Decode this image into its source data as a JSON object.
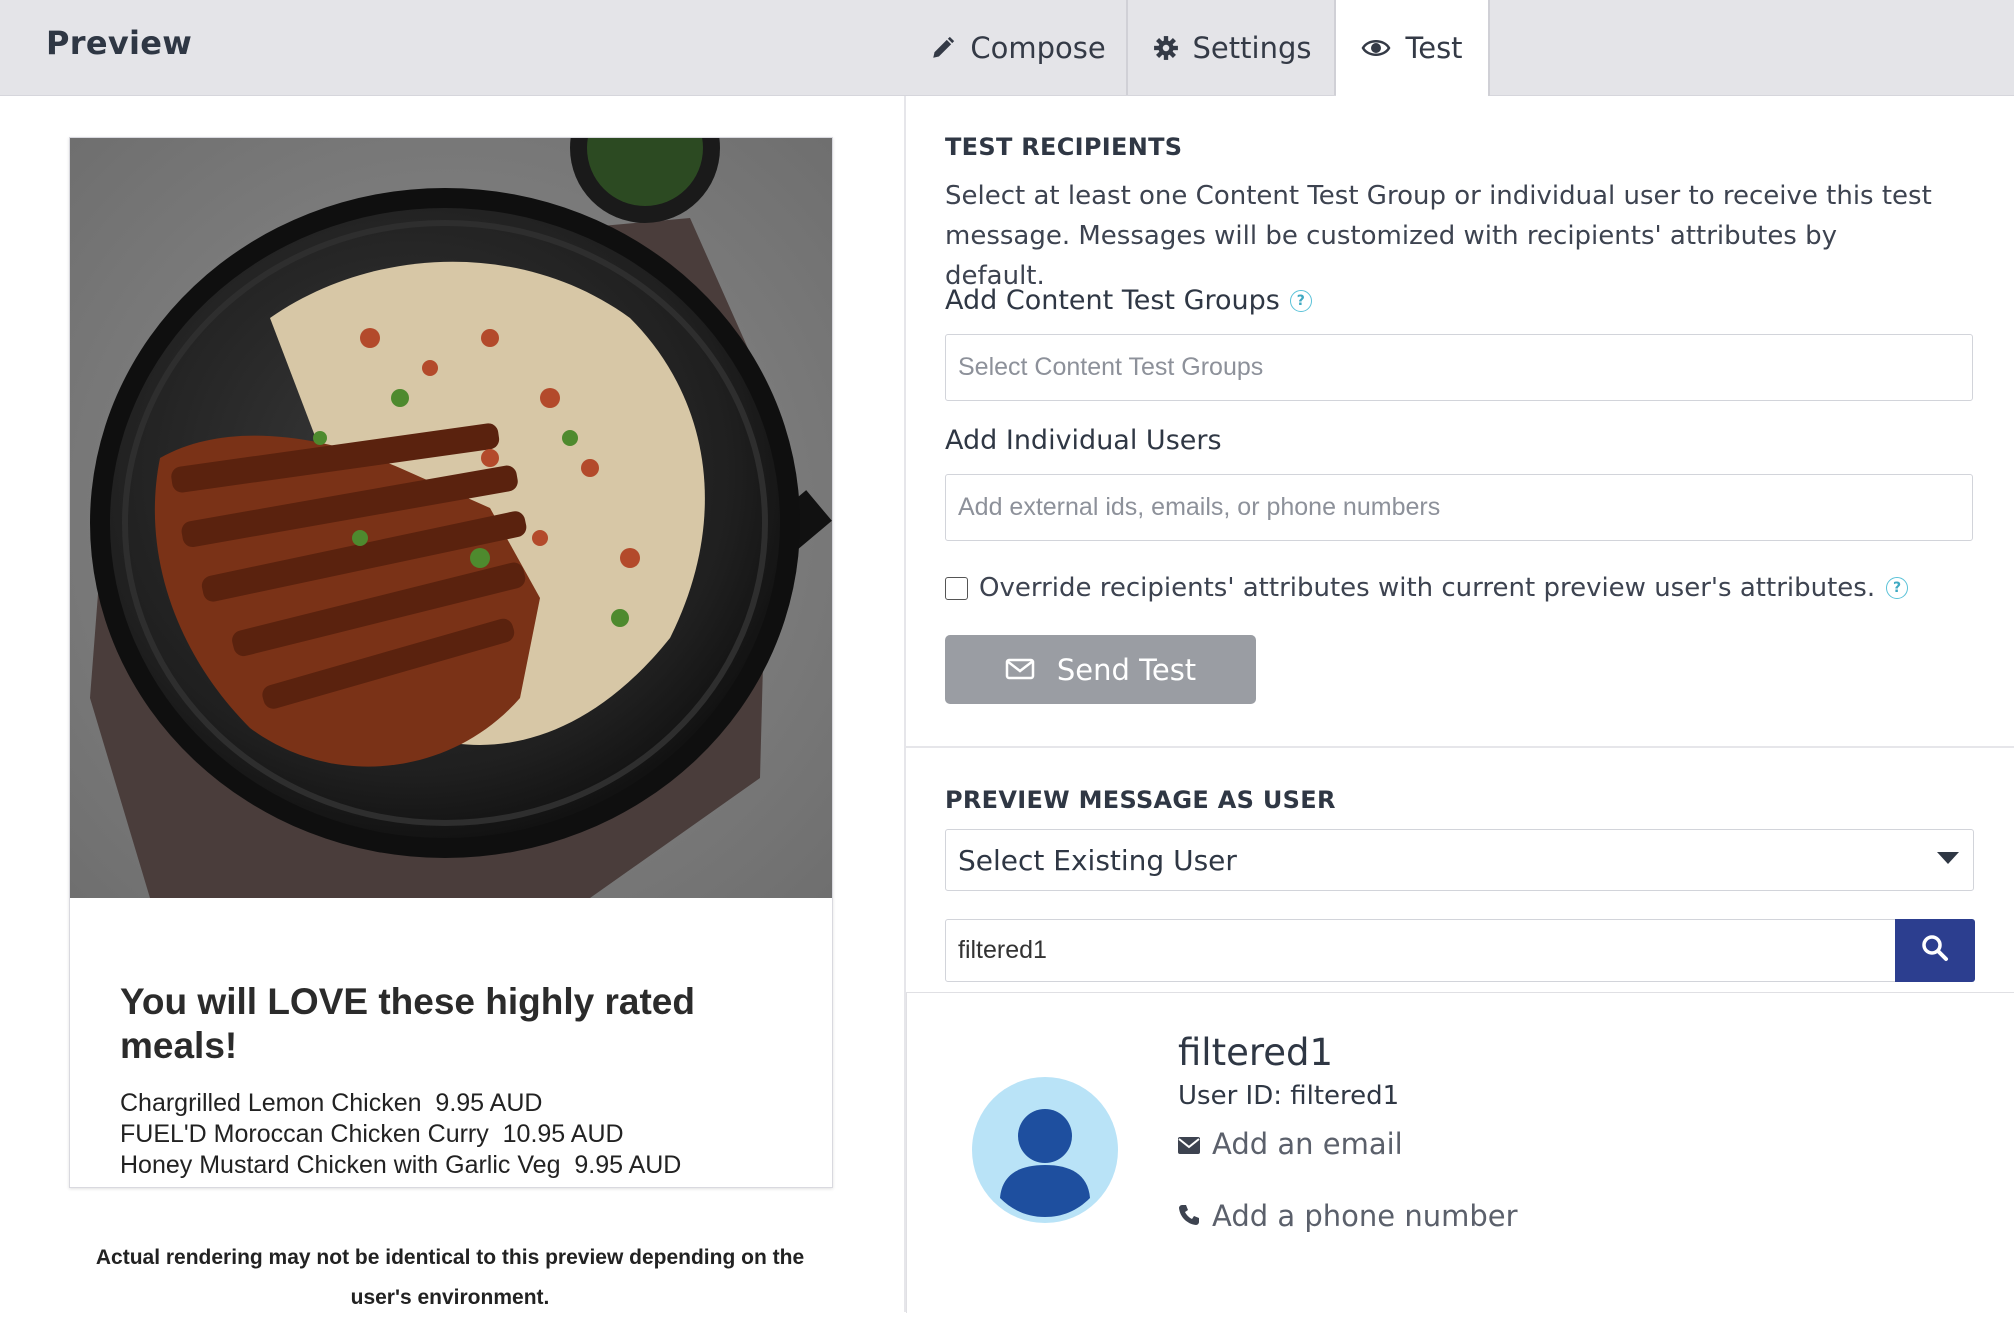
{
  "header": {
    "title": "Preview",
    "tabs": [
      {
        "label": "Compose",
        "icon": "pencil-icon"
      },
      {
        "label": "Settings",
        "icon": "gear-icon"
      },
      {
        "label": "Test",
        "icon": "eye-icon",
        "active": true
      }
    ]
  },
  "preview": {
    "card_title": "You will LOVE these highly rated meals!",
    "meals": [
      "Chargrilled Lemon Chicken  9.95 AUD",
      "FUEL'D Moroccan Chicken Curry  10.95 AUD",
      "Honey Mustard Chicken with Garlic Veg  9.95 AUD"
    ],
    "disclaimer": "Actual rendering may not be identical to this preview depending on the user's environment."
  },
  "test_recipients": {
    "heading": "TEST RECIPIENTS",
    "description": "Select at least one Content Test Group or individual user to receive this test message. Messages will be customized with recipients' attributes by default.",
    "groups_label": "Add Content Test Groups",
    "groups_placeholder": "Select Content Test Groups",
    "users_label": "Add Individual Users",
    "users_placeholder": "Add external ids, emails, or phone numbers",
    "override_label": "Override recipients' attributes with current preview user's attributes.",
    "send_label": "Send Test"
  },
  "preview_as_user": {
    "heading": "PREVIEW MESSAGE AS USER",
    "select_value": "Select Existing User",
    "search_value": "filtered1"
  },
  "user": {
    "name": "filtered1",
    "user_id": "User ID: filtered1",
    "add_email": "Add an email",
    "add_phone": "Add a phone number"
  },
  "colors": {
    "accent": "#2c3e8f",
    "button_disabled": "#9a9da3",
    "avatar_bg": "#b9e3f7",
    "avatar_fg": "#1e4f9f",
    "help": "#5ac2d8"
  }
}
